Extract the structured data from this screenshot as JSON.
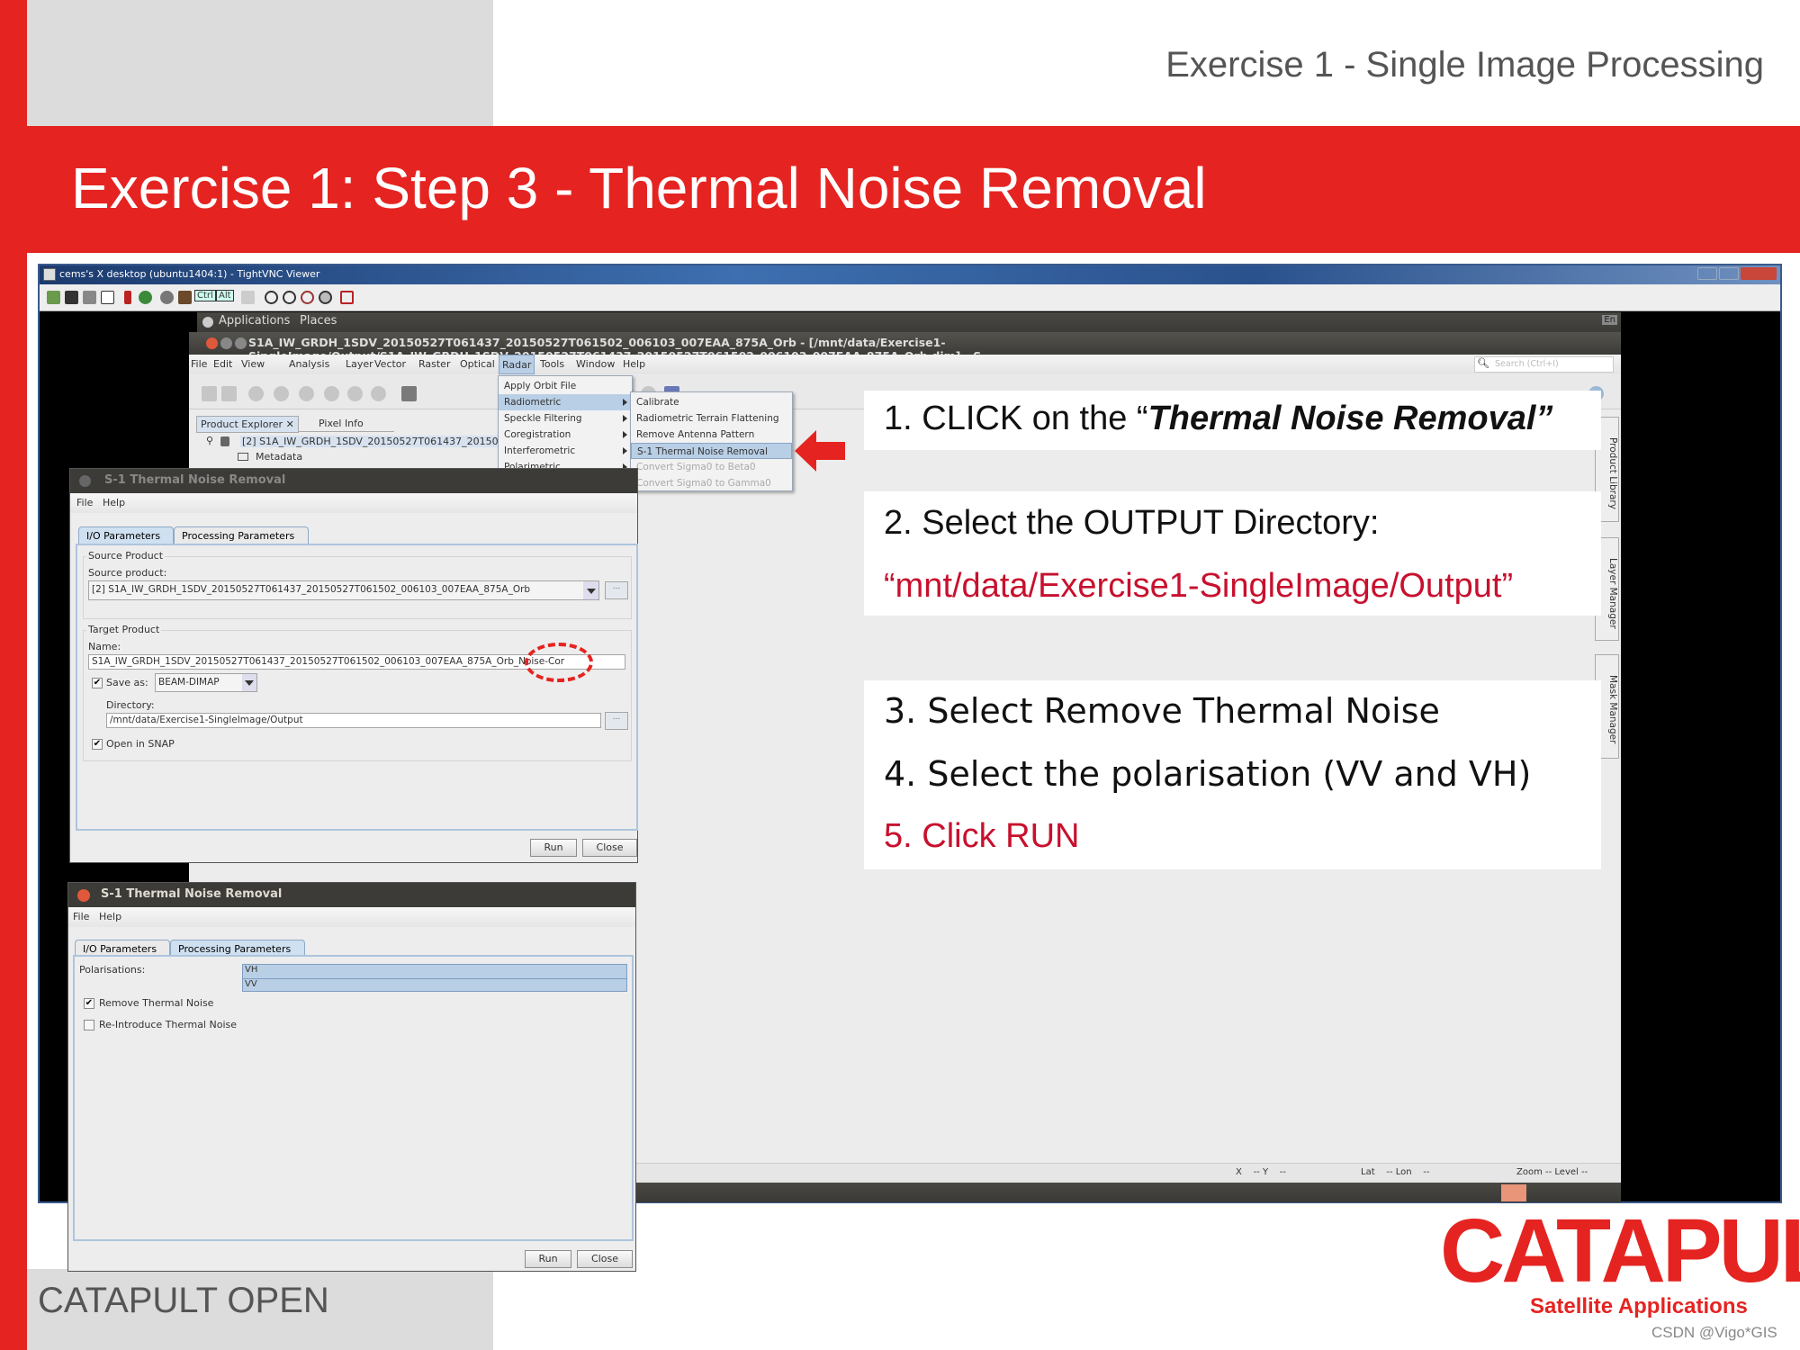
{
  "slide": {
    "header": "Exercise 1 - Single Image Processing",
    "title": "Exercise 1: Step 3 - Thermal Noise Removal",
    "footer": "CATAPULT OPEN",
    "logo": {
      "wordmark": "CATAPULT",
      "subtitle": "Satellite Applications"
    },
    "watermark": "CSDN @Vigo*GIS",
    "colors": {
      "brand_red": "#e52421",
      "emphasis_red": "#c8102e",
      "menu_highlight": "#b9cfe6"
    }
  },
  "vnc": {
    "title": "cems's X desktop (ubuntu1404:1) - TightVNC Viewer",
    "ctrl": "Ctrl",
    "alt": "Alt"
  },
  "ubuntu_panel": {
    "applications": "Applications",
    "places": "Places",
    "keyboard": "En"
  },
  "snap": {
    "title": "S1A_IW_GRDH_1SDV_20150527T061437_20150527T061502_006103_007EAA_875A_Orb - [/mnt/data/Exercise1-SingleImage/Output/S1A_IW_GRDH_1SDV_20150527T061437_20150527T061502_006103_007EAA_875A_Orb.dim] - S",
    "menu": [
      "File",
      "Edit",
      "View",
      "Analysis",
      "Layer",
      "Vector",
      "Raster",
      "Optical",
      "Radar",
      "Tools",
      "Window",
      "Help"
    ],
    "search_placeholder": "Search (Ctrl+I)",
    "radar_menu": [
      "Apply Orbit File",
      "Radiometric",
      "Speckle Filtering",
      "Coregistration",
      "Interferometric",
      "Polarimetric"
    ],
    "radiometric_submenu": [
      "Calibrate",
      "Radiometric Terrain Flattening",
      "Remove Antenna Pattern",
      "S-1 Thermal Noise Removal",
      "Convert Sigma0 to Beta0",
      "Convert Sigma0 to Gamma0"
    ],
    "explorer_tabs": [
      "Product Explorer",
      "Pixel Info"
    ],
    "tree": [
      "[2] S1A_IW_GRDH_1SDV_20150527T061437_20150527",
      "Metadata"
    ],
    "dock_tabs": [
      "Product Library",
      "Layer Manager",
      "Mask Manager"
    ],
    "status": {
      "xy": "X    -- Y    --",
      "latlon": "Lat    -- Lon    --",
      "zoom": "Zoom -- Level --"
    }
  },
  "dialog_io": {
    "title": "S-1 Thermal Noise Removal",
    "menu": [
      "File",
      "Help"
    ],
    "tabs": [
      "I/O Parameters",
      "Processing Parameters"
    ],
    "source_group": "Source Product",
    "source_label": "Source product:",
    "source_value": "[2] S1A_IW_GRDH_1SDV_20150527T061437_20150527T061502_006103_007EAA_875A_Orb",
    "target_group": "Target Product",
    "name_label": "Name:",
    "name_value": "S1A_IW_GRDH_1SDV_20150527T061437_20150527T061502_006103_007EAA_875A_Orb_Noise-Cor",
    "save_as_label": "Save as:",
    "save_as_checked": true,
    "format": "BEAM-DIMAP",
    "directory_label": "Directory:",
    "directory_value": "/mnt/data/Exercise1-SingleImage/Output",
    "open_in_snap_label": "Open in SNAP",
    "open_in_snap_checked": true,
    "browse": "...",
    "run": "Run",
    "close": "Close"
  },
  "dialog_proc": {
    "title": "S-1 Thermal Noise Removal",
    "menu": [
      "File",
      "Help"
    ],
    "tabs": [
      "I/O Parameters",
      "Processing Parameters"
    ],
    "polarisations_label": "Polarisations:",
    "polarisations": [
      "VH",
      "VV"
    ],
    "remove_label": "Remove Thermal Noise",
    "remove_checked": true,
    "reintroduce_label": "Re-Introduce Thermal Noise",
    "reintroduce_checked": false,
    "run": "Run",
    "close": "Close"
  },
  "instructions": {
    "step1_prefix": "1. CLICK on the “",
    "step1_emphasis": "Thermal Noise Removal”",
    "step2": "2. Select the OUTPUT Directory:",
    "step2_path": "“mnt/data/Exercise1-SingleImage/Output”",
    "step3": "3. Select Remove Thermal Noise",
    "step4": "4. Select the polarisation (VV and VH)",
    "step5": "5. Click RUN"
  }
}
